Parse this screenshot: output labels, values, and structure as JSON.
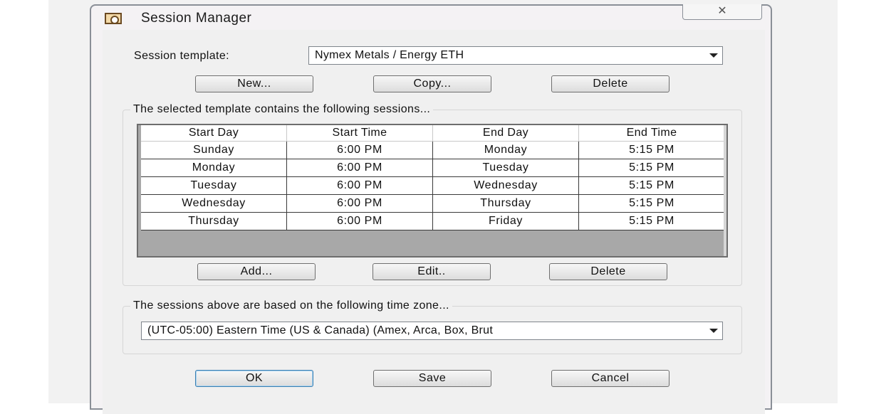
{
  "window": {
    "title": "Session Manager",
    "close_label": "✕"
  },
  "template_section": {
    "label": "Session template:",
    "selected": "Nymex Metals / Energy ETH",
    "buttons": {
      "new": "New...",
      "copy": "Copy...",
      "delete": "Delete"
    }
  },
  "sessions": {
    "group_title": "The selected template contains the following sessions...",
    "columns": [
      "Start Day",
      "Start Time",
      "End Day",
      "End Time"
    ],
    "rows": [
      [
        "Sunday",
        "6:00 PM",
        "Monday",
        "5:15 PM"
      ],
      [
        "Monday",
        "6:00 PM",
        "Tuesday",
        "5:15 PM"
      ],
      [
        "Tuesday",
        "6:00 PM",
        "Wednesday",
        "5:15 PM"
      ],
      [
        "Wednesday",
        "6:00 PM",
        "Thursday",
        "5:15 PM"
      ],
      [
        "Thursday",
        "6:00 PM",
        "Friday",
        "5:15 PM"
      ]
    ],
    "buttons": {
      "add": "Add...",
      "edit": "Edit..",
      "delete": "Delete"
    }
  },
  "timezone": {
    "group_title": "The sessions above are based on the following time zone...",
    "selected": "(UTC-05:00) Eastern Time (US & Canada) (Amex, Arca, Box, Brut"
  },
  "footer": {
    "ok": "OK",
    "save": "Save",
    "cancel": "Cancel"
  }
}
